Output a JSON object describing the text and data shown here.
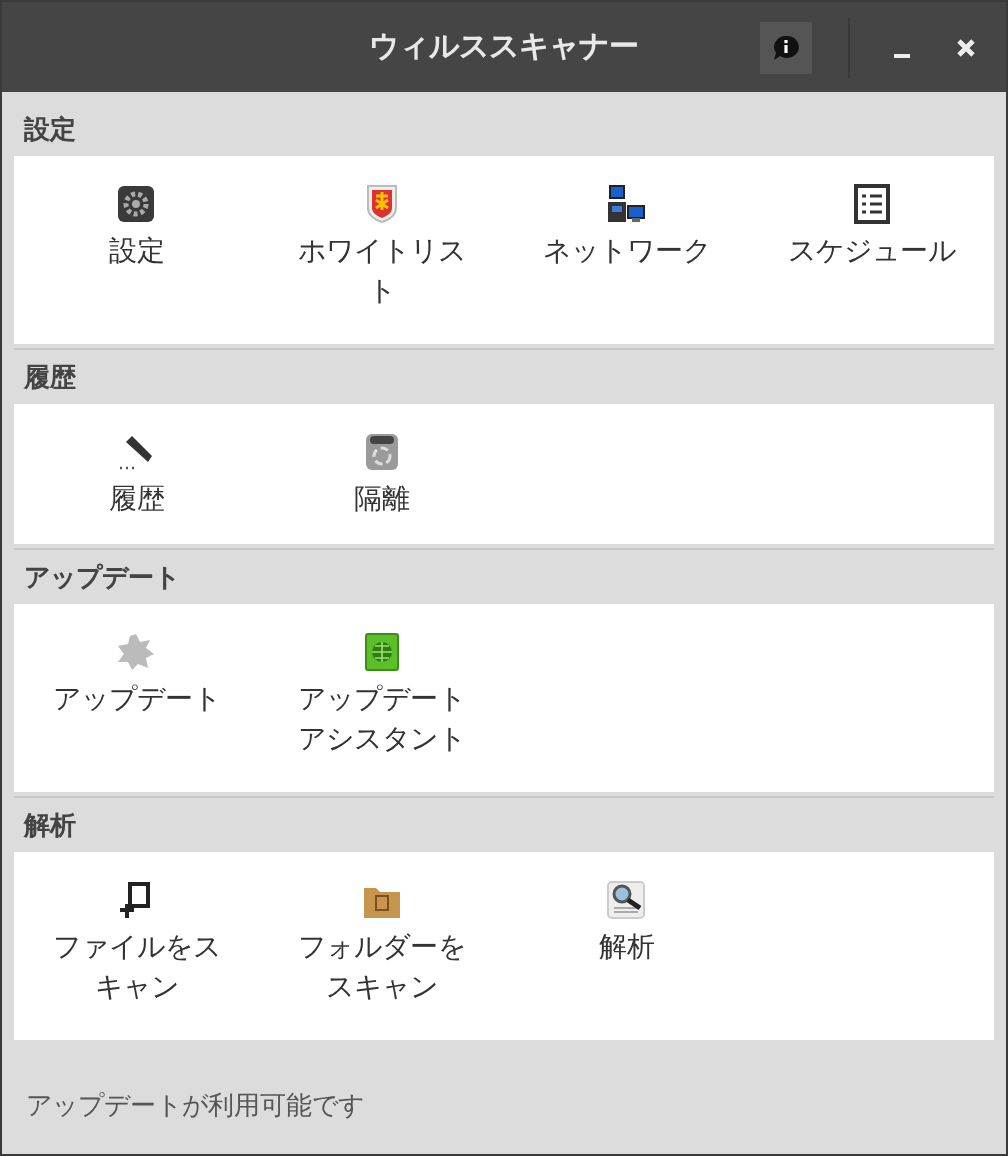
{
  "window": {
    "title": "ウィルススキャナー"
  },
  "sections": [
    {
      "title": "設定",
      "items": [
        {
          "label": "設定"
        },
        {
          "label": "ホワイトリスト"
        },
        {
          "label": "ネットワーク"
        },
        {
          "label": "スケジュール"
        }
      ]
    },
    {
      "title": "履歴",
      "items": [
        {
          "label": "履歴"
        },
        {
          "label": "隔離"
        }
      ]
    },
    {
      "title": "アップデート",
      "items": [
        {
          "label": "アップデート"
        },
        {
          "label": "アップデートアシスタント"
        }
      ]
    },
    {
      "title": "解析",
      "items": [
        {
          "label": "ファイルをスキャン"
        },
        {
          "label": "フォルダーをスキャン"
        },
        {
          "label": "解析"
        }
      ]
    }
  ],
  "status_bar": {
    "text": "アップデートが利用可能です"
  }
}
